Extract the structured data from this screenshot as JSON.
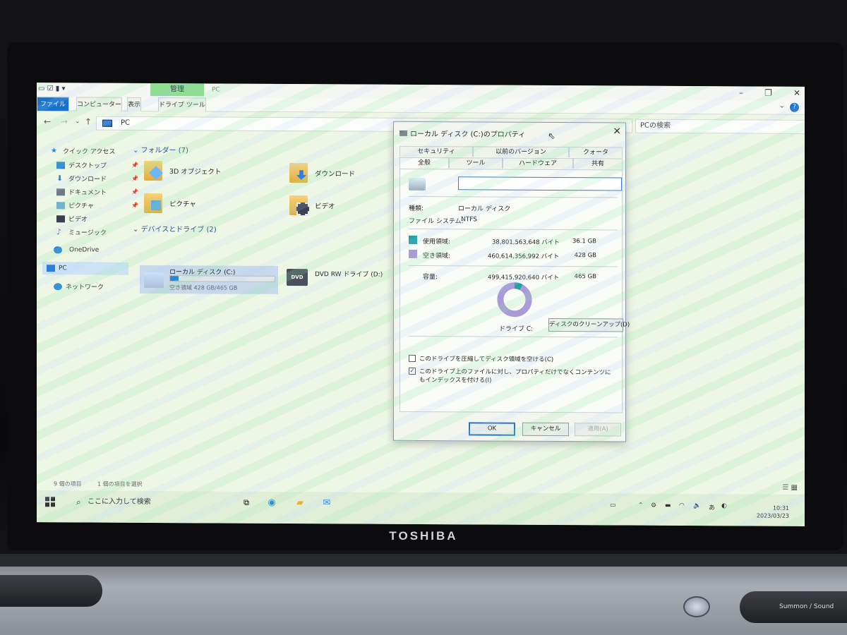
{
  "device": {
    "brand": "TOSHIBA",
    "bottom_label": "Summon / Sound"
  },
  "explorer": {
    "window_title": "PC",
    "ribbon_context_tab": "管理",
    "ribbon_tabs": [
      "ファイル",
      "コンピューター",
      "表示",
      "ドライブ ツール"
    ],
    "address": "PC",
    "search_placeholder": "PCの検索",
    "nav_pane": {
      "quick_access": "クイック アクセス",
      "items": [
        "デスクトップ",
        "ダウンロード",
        "ドキュメント",
        "ピクチャ",
        "ビデオ",
        "ミュージック"
      ],
      "onedrive": "OneDrive",
      "pc": "PC",
      "network": "ネットワーク"
    },
    "folders_header": "フォルダー (7)",
    "folders": [
      "3D オブジェクト",
      "ダウンロード",
      "ピクチャ",
      "ビデオ"
    ],
    "devices_header": "デバイスとドライブ (2)",
    "drive_c": {
      "label": "ローカル ディスク (C:)",
      "free": "空き領域 428 GB/465 GB",
      "used_fraction": 0.08
    },
    "dvd": {
      "label": "DVD RW ドライブ (D:)",
      "badge": "DVD"
    },
    "status": {
      "items": "9 個の項目",
      "selected": "1 個の項目を選択"
    }
  },
  "dialog": {
    "title": "ローカル ディスク (C:)のプロパティ",
    "tabs_row1": [
      "セキュリティ",
      "以前のバージョン",
      "クォータ"
    ],
    "tabs_row2": [
      "全般",
      "ツール",
      "ハードウェア",
      "共有"
    ],
    "name_value": "",
    "type_label": "種類:",
    "type_value": "ローカル ディスク",
    "fs_label": "ファイル システム:",
    "fs_value": "NTFS",
    "used": {
      "label": "使用領域:",
      "bytes": "38,801,563,648 バイト",
      "size": "36.1 GB",
      "color": "#1fa1a1"
    },
    "free": {
      "label": "空き領域:",
      "bytes": "460,614,356,992 バイト",
      "size": "428 GB",
      "color": "#a99bd6"
    },
    "capacity": {
      "label": "容量:",
      "bytes": "499,415,920,640 バイト",
      "size": "465 GB"
    },
    "drive_label": "ドライブ C:",
    "used_fraction": 0.078,
    "cleanup_button": "ディスクのクリーンアップ(D)",
    "compress_checkbox": {
      "label": "このドライブを圧縮してディスク領域を空ける(C)",
      "checked": false
    },
    "index_checkbox": {
      "label": "このドライブ上のファイルに対し、プロパティだけでなくコンテンツにもインデックスを付ける(I)",
      "checked": true
    },
    "ok": "OK",
    "cancel": "キャンセル",
    "apply": "適用(A)"
  },
  "taskbar": {
    "search_placeholder": "ここに入力して検索",
    "time": "10:31",
    "date": "2023/03/23"
  }
}
